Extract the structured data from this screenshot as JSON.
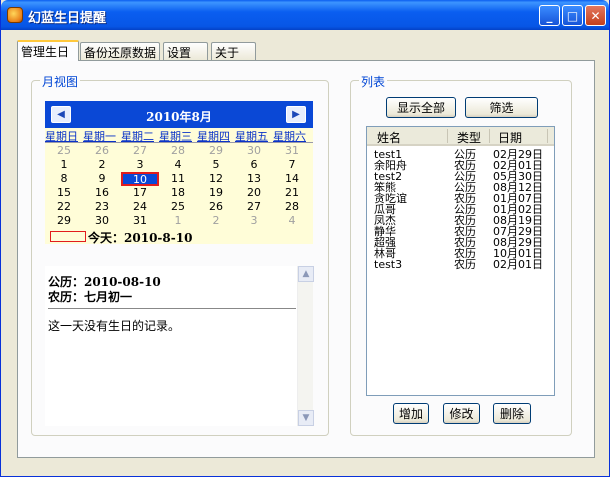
{
  "window": {
    "title": "幻蓝生日提醒",
    "minimize_glyph": "_",
    "maximize_glyph": "□",
    "close_glyph": "✕"
  },
  "tabs": [
    "管理生日",
    "备份还原数据",
    "设置",
    "关于"
  ],
  "month_view": {
    "group_title": "月视图",
    "header": "2010年8月",
    "prev_glyph": "◀",
    "next_glyph": "▶",
    "weekdays": [
      "星期日",
      "星期一",
      "星期二",
      "星期三",
      "星期四",
      "星期五",
      "星期六"
    ],
    "weeks": [
      [
        "25",
        "26",
        "27",
        "28",
        "29",
        "30",
        "31"
      ],
      [
        "1",
        "2",
        "3",
        "4",
        "5",
        "6",
        "7"
      ],
      [
        "8",
        "9",
        "10",
        "11",
        "12",
        "13",
        "14"
      ],
      [
        "15",
        "16",
        "17",
        "18",
        "19",
        "20",
        "21"
      ],
      [
        "22",
        "23",
        "24",
        "25",
        "26",
        "27",
        "28"
      ],
      [
        "29",
        "30",
        "31",
        "1",
        "2",
        "3",
        "4"
      ]
    ],
    "selected_day": "10",
    "today_label": "今天：",
    "today_value": "2010-8-10",
    "info": {
      "solar_label": "公历：",
      "solar_value": "2010-08-10",
      "lunar_label": "农历：",
      "lunar_value": "七月初一",
      "message": "这一天没有生日的记录。"
    }
  },
  "list_panel": {
    "group_title": "列表",
    "show_all_button": "显示全部",
    "filter_button": "筛选",
    "columns": [
      "姓名",
      "类型",
      "日期"
    ],
    "rows": [
      [
        "test1",
        "公历",
        "02月29日"
      ],
      [
        "余阳舟",
        "农历",
        "02月01日"
      ],
      [
        "test2",
        "公历",
        "05月30日"
      ],
      [
        "笨熊",
        "公历",
        "08月12日"
      ],
      [
        "贪吃谊",
        "农历",
        "01月07日"
      ],
      [
        "瓜哥",
        "公历",
        "01月02日"
      ],
      [
        "凤杰",
        "农历",
        "08月19日"
      ],
      [
        "静华",
        "农历",
        "07月29日"
      ],
      [
        "超强",
        "农历",
        "08月29日"
      ],
      [
        "林哥",
        "农历",
        "10月01日"
      ],
      [
        "test3",
        "农历",
        "02月01日"
      ]
    ],
    "add_button": "增加",
    "edit_button": "修改",
    "delete_button": "删除"
  },
  "colors": {
    "title_bar": "#0a5ef0",
    "calendar_header": "#0a48d6",
    "calendar_bg": "#fffdd8",
    "selection_border": "#e21c1c",
    "group_title": "#0046d5"
  },
  "icons": {
    "app": "app-icon",
    "prev": "prev-month-icon",
    "next": "next-month-icon"
  }
}
